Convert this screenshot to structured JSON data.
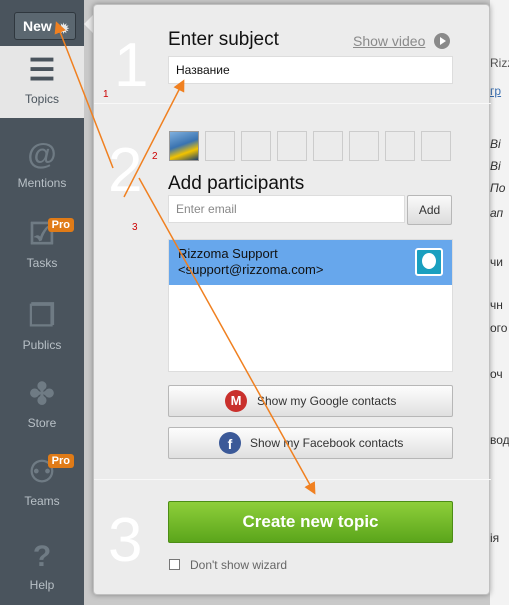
{
  "sidebar": {
    "new_label": "New",
    "items": [
      {
        "label": "Topics",
        "icon": "topics-icon"
      },
      {
        "label": "Mentions",
        "icon": "mentions-icon"
      },
      {
        "label": "Tasks",
        "icon": "tasks-icon",
        "badge": "Pro"
      },
      {
        "label": "Publics",
        "icon": "publics-icon"
      },
      {
        "label": "Store",
        "icon": "store-icon"
      },
      {
        "label": "Teams",
        "icon": "teams-icon",
        "badge": "Pro"
      },
      {
        "label": "Help",
        "icon": "help-icon"
      }
    ]
  },
  "background": {
    "fragments": [
      "Rizz",
      "гр",
      "Ві",
      "Ві",
      "По",
      "ап",
      "чи",
      "чн",
      "ого",
      "оч",
      "вод",
      "ія"
    ]
  },
  "wizard": {
    "step1": {
      "number": "1",
      "heading": "Enter subject",
      "video_link": "Show video",
      "subject_value": "Название"
    },
    "step2": {
      "number": "2",
      "heading": "Add participants",
      "email_placeholder": "Enter email",
      "add_label": "Add",
      "participant_name": "Rizzoma Support",
      "participant_email": "<support@rizzoma.com>",
      "google_label": "Show my Google contacts",
      "facebook_label": "Show my Facebook contacts"
    },
    "step3": {
      "number": "3",
      "create_label": "Create new topic",
      "dont_show_label": "Don't show wizard"
    }
  },
  "annotations": [
    "1",
    "2",
    "3"
  ],
  "colors": {
    "sidebar": "#4a545d",
    "create_green": "#6cb82a",
    "participant_highlight": "#67a7ec",
    "arrow": "#f08020",
    "annotation": "#cc0000"
  }
}
